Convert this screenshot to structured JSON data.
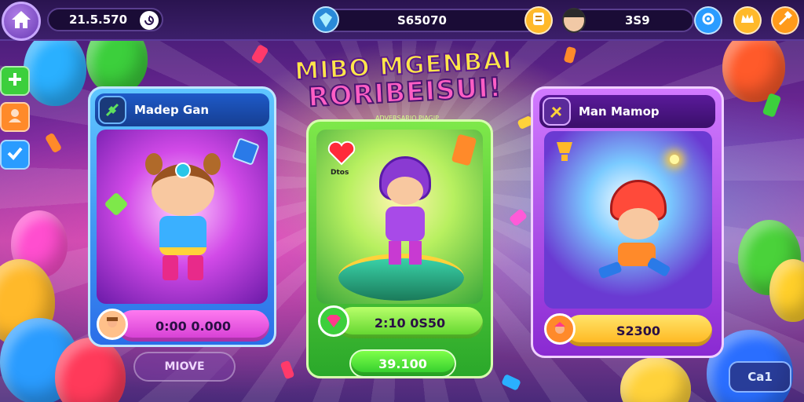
{
  "topbar": {
    "coins_value": "21.5.570",
    "gems_value": "S65070",
    "player_value": "3S9"
  },
  "title": {
    "line1": "MIBO MGENBAI",
    "line2": "RORIBEISUI!",
    "subtitle": "ADVERSARIO PIAGIP"
  },
  "cards": [
    {
      "name": "Madep Gan",
      "price": "0:00 0.000",
      "button": "MIOVE"
    },
    {
      "name": "",
      "badge_text": "Dtos",
      "price": "2:10 0S50",
      "button": "39.100"
    },
    {
      "name": "Man Mamop",
      "price": "S2300",
      "button": ""
    }
  ],
  "bottom_right_button": "Ca1",
  "colors": {
    "card1_accent": "#3aa0ff",
    "card2_accent": "#4ad24a",
    "card3_accent": "#b04ae0",
    "price_pink": "#e85ae8",
    "price_green": "#7ee84a",
    "price_yellow": "#ffd23a"
  },
  "icons": [
    "home-icon",
    "settings-icon",
    "plus-icon",
    "profile-icon",
    "check-icon",
    "gem-icon",
    "coin-icon",
    "leaf-icon",
    "hammer-icon",
    "heart-icon"
  ]
}
